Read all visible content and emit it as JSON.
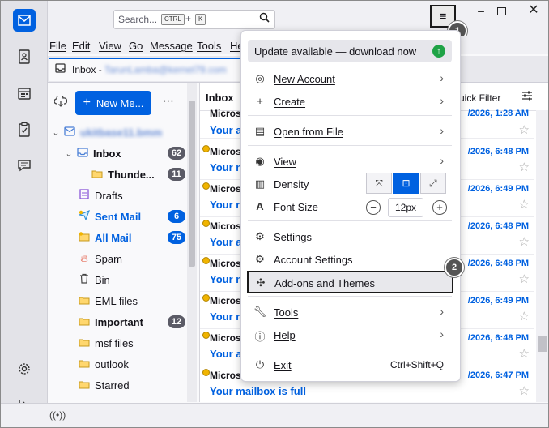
{
  "search": {
    "placeholder": "Search...",
    "key1": "CTRL",
    "plus": "+",
    "key2": "K"
  },
  "window": {
    "minimize": "–",
    "maximize": "",
    "close": "✕"
  },
  "hamburger_icon": "≡",
  "step_badges": [
    "1",
    "2"
  ],
  "menubar": [
    "File",
    "Edit",
    "View",
    "Go",
    "Message",
    "Tools",
    "He"
  ],
  "tab": {
    "title": "Inbox - "
  },
  "folder_pane": {
    "new_message": "New Me...",
    "account_name": "ukitbase11.bmm",
    "folders": [
      {
        "name": "Inbox",
        "count": "62"
      },
      {
        "name": "Thunde...",
        "count": "11"
      },
      {
        "name": "Drafts",
        "count": ""
      },
      {
        "name": "Sent Mail",
        "count": "6"
      },
      {
        "name": "All Mail",
        "count": "75"
      },
      {
        "name": "Spam",
        "count": ""
      },
      {
        "name": "Bin",
        "count": ""
      },
      {
        "name": "EML files",
        "count": ""
      },
      {
        "name": "Important",
        "count": "12"
      },
      {
        "name": "msf files",
        "count": ""
      },
      {
        "name": "outlook",
        "count": ""
      },
      {
        "name": "Starred",
        "count": ""
      }
    ]
  },
  "message_list": {
    "title": "Inbox",
    "quick_filter": "uick Filter",
    "rows": [
      {
        "from": "Micros",
        "date": "/2026, 1:28 AM",
        "subject": "Your a"
      },
      {
        "from": "Micros",
        "date": "/2026, 6:48 PM",
        "subject": "Your n"
      },
      {
        "from": "Micros",
        "date": "/2026, 6:49 PM",
        "subject": "Your r"
      },
      {
        "from": "Micros",
        "date": "/2026, 6:48 PM",
        "subject": "Your a"
      },
      {
        "from": "Micros",
        "date": "/2026, 6:48 PM",
        "subject": "Your n"
      },
      {
        "from": "Micros",
        "date": "/2026, 6:49 PM",
        "subject": "Your r"
      },
      {
        "from": "Micros",
        "date": "/2026, 6:48 PM",
        "subject": "Your a"
      },
      {
        "from": "Micros",
        "date": "/2026, 6:47 PM",
        "subject": "Your mailbox is full"
      }
    ]
  },
  "app_menu": {
    "update": "Update available — download now",
    "new_account": "New Account",
    "create": "Create",
    "open_from_file": "Open from File",
    "view": "View",
    "density": "Density",
    "font_size": "Font Size",
    "font_size_value": "12px",
    "font_minus": "−",
    "font_plus": "+",
    "settings": "Settings",
    "account_settings": "Account Settings",
    "addons": "Add-ons and Themes",
    "tools": "Tools",
    "help": "Help",
    "exit": "Exit",
    "exit_shortcut": "Ctrl+Shift+Q"
  }
}
